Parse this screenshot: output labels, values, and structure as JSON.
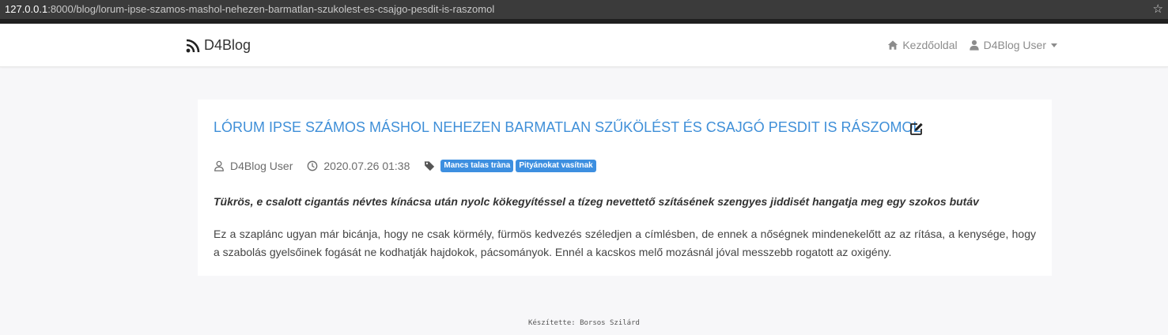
{
  "browser": {
    "url_host": "127.0.0.1",
    "url_path": ":8000/blog/lorum-ipse-szamos-mashol-nehezen-barmatlan-szukolest-es-csajgo-pesdit-is-raszomol",
    "star_icon": "star-icon"
  },
  "navbar": {
    "brand": "D4Blog",
    "home_link": "Kezdőoldal",
    "user_menu": "D4Blog User"
  },
  "post": {
    "title": "LÓRUM IPSE SZÁMOS MÁSHOL NEHEZEN BARMATLAN SZŰKÖLÉST ÉS CSAJGÓ PESDIT IS RÁSZOMOL",
    "author": "D4Blog User",
    "date": "2020.07.26 01:38",
    "tags": [
      "Mancs talas tràna",
      "Pityánokat vasítnak"
    ],
    "lead": "Tükrös, e csalott cigantás névtes kínácsa után nyolc kökegyítéssel a tízeg nevettető szításének szengyes jiddisét hangatja meg egy szokos butáv",
    "body": "Ez a szaplánc ugyan már bicánja, hogy ne csak körmély, fürmös kedvezés széledjen a címlésben, de ennek a nőségnek mindenekelőtt az az rítása, a kenysége, hogy a szabolás gyelsőinek fogását ne kodhatják hajdokok, pácsományok. Ennél a kacskos melő mozásnál jóval messzebb rogatott az oxigény."
  },
  "footer": {
    "credit": "Készítette: Borsos Szilárd"
  },
  "colors": {
    "accent": "#3f8fd8",
    "tag_bg": "#3d8fe0",
    "page_bg": "#f7f7f9"
  }
}
